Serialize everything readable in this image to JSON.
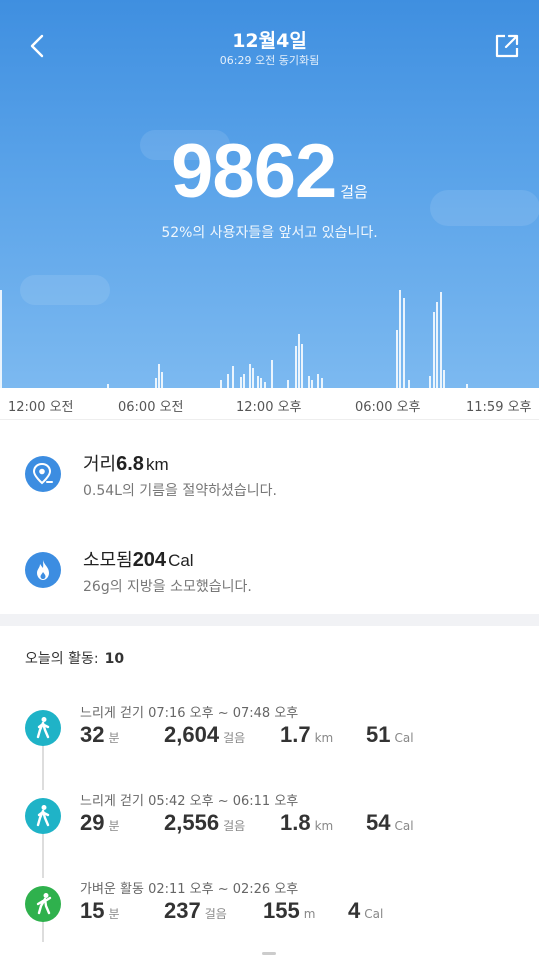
{
  "header": {
    "date": "12월4일",
    "sync_status": "06:29 오전 동기화됨"
  },
  "summary": {
    "steps": "9862",
    "steps_unit": "걸음",
    "rank_text": "52%의 사용자들을 앞서고 있습니다."
  },
  "timeline": {
    "labels": [
      "12:00 오전",
      "06:00 오전",
      "12:00 오후",
      "06:00 오후",
      "11:59 오후"
    ]
  },
  "distance": {
    "label": "거리",
    "value": "6.8",
    "unit": "km",
    "sub": "0.54L의 기름을 절약하셨습니다."
  },
  "calories": {
    "label": "소모됨",
    "value": "204",
    "unit": "Cal",
    "sub": "26g의 지방을 소모했습니다."
  },
  "activities": {
    "header_label": "오늘의 활동:",
    "count": "10",
    "items": [
      {
        "icon": "walk-icon",
        "title": "느리게 걷기 07:16 오후 ~ 07:48 오후",
        "minutes": "32",
        "minutes_unit": "분",
        "steps": "2,604",
        "steps_unit": "걸음",
        "distance": "1.7",
        "distance_unit": "km",
        "calories": "51",
        "calories_unit": "Cal"
      },
      {
        "icon": "walk-icon",
        "title": "느리게 걷기 05:42 오후 ~ 06:11 오후",
        "minutes": "29",
        "minutes_unit": "분",
        "steps": "2,556",
        "steps_unit": "걸음",
        "distance": "1.8",
        "distance_unit": "km",
        "calories": "54",
        "calories_unit": "Cal"
      },
      {
        "icon": "light-activity-icon",
        "title": "가벼운 활동 02:11 오후 ~ 02:26 오후",
        "minutes": "15",
        "minutes_unit": "분",
        "steps": "237",
        "steps_unit": "걸음",
        "distance": "155",
        "distance_unit": "m",
        "calories": "4",
        "calories_unit": "Cal"
      }
    ]
  },
  "colors": {
    "hero_top": "#3f8fe0",
    "hero_bottom": "#7cb9f0",
    "metric_icon": "#3c8de1",
    "walk_icon": "#1fb3c7",
    "light_activity_icon": "#2fb14d"
  }
}
